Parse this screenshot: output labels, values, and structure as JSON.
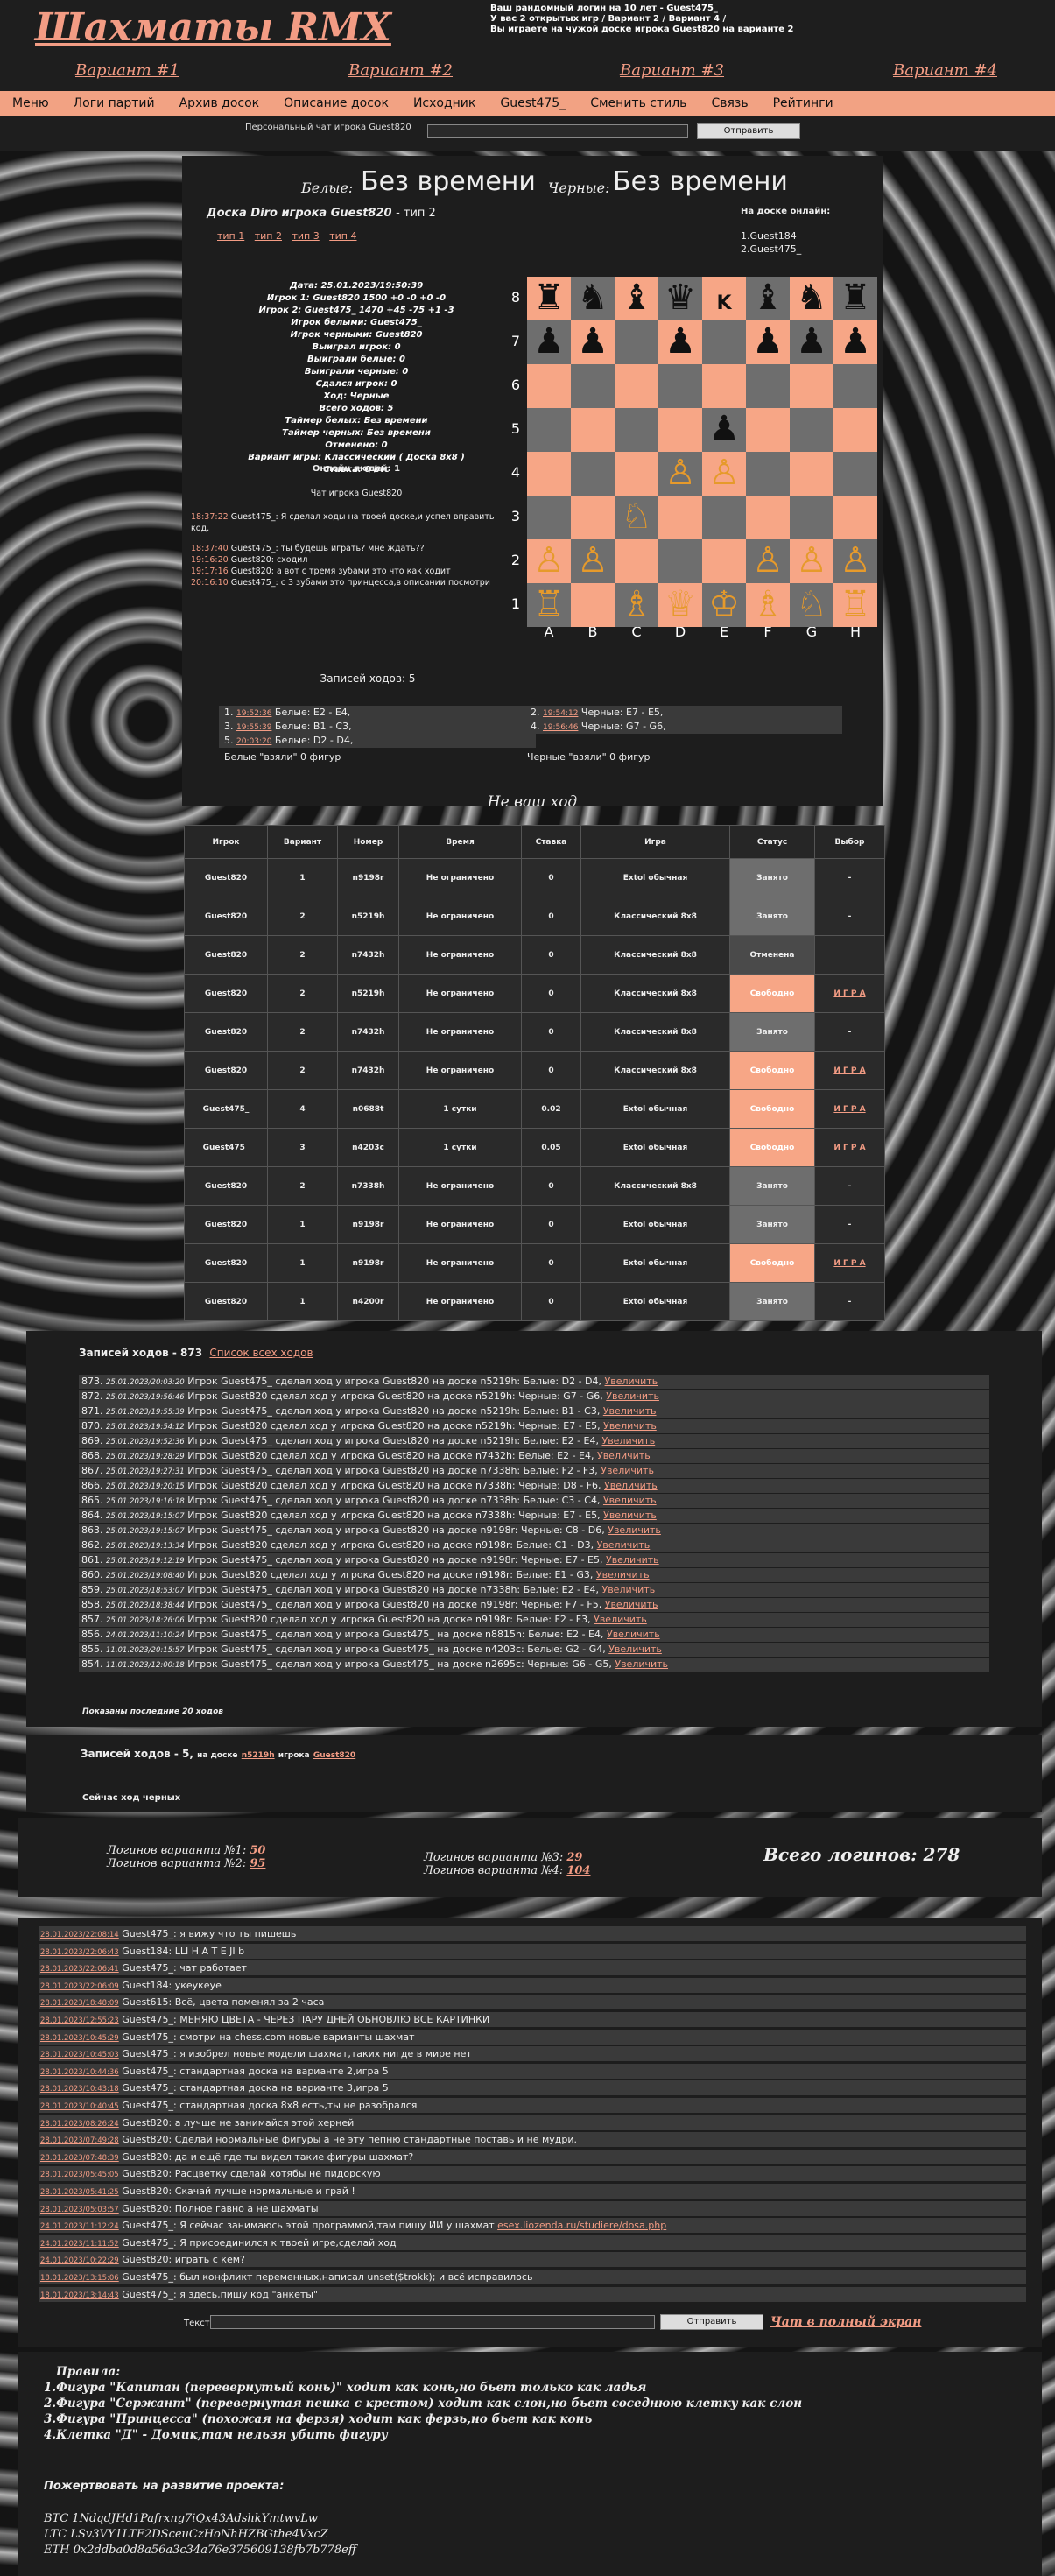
{
  "site": {
    "logo": "Шахматы RMX",
    "info": [
      "Ваш рандомный логин на 10 лет - Guest475_",
      "У вас 2 открытых игр / Вариант 2 / Вариант 4 /",
      "Вы играете на чужой доске игрока Guest820 на варианте 2"
    ]
  },
  "variants": [
    "Вариант #1",
    "Вариант #2",
    "Вариант #3",
    "Вариант #4"
  ],
  "menu": [
    "Меню",
    "Логи партий",
    "Архив досок",
    "Описание досок",
    "Исходник",
    "Guest475_",
    "Сменить стиль",
    "Связь",
    "Рейтинги"
  ],
  "private_chat": {
    "label": "Персональный чат игрока Guest820",
    "button": "Отправить"
  },
  "timers": {
    "white_label": "Белые:",
    "white_value": "Без времени",
    "black_label": "Черные:",
    "black_value": "Без времени"
  },
  "board_header": {
    "title": "Доска Diro игрока Guest820",
    "subtitle": "- тип 2",
    "types": [
      "тип 1",
      "тип 2",
      "тип 3",
      "тип 4"
    ],
    "online_label": "На доске онлайн:",
    "online": [
      "1.Guest184",
      "2.Guest475_"
    ]
  },
  "details": [
    "Дата: 25.01.2023/19:50:39",
    "Игрок 1: Guest820 1500 +0 -0 +0 -0",
    "Игрок 2: Guest475_ 1470 +45 -75 +1 -3",
    "Игрок белыми: Guest475_",
    "Игрок черными: Guest820",
    "Выиграл игрок: 0",
    "Выиграли белые: 0",
    "Выиграли черные: 0",
    "Сдался игрок: 0",
    "Ход: Черные",
    "Всего ходов: 5",
    "Таймер белых: Без времени",
    "Таймер черных: Без времени",
    "Отменено: 0",
    "Вариант игры: Классический ( Доска 8x8 )",
    "Ставка: 0 btc"
  ],
  "online_people": "Онлайн людей: 1",
  "board_chat": {
    "title": "Чат игрока Guest820",
    "messages": [
      {
        "time": "18:37:22",
        "text": "Guest475_: Я сделал ходы на твоей доске,и успел вправить код."
      },
      {
        "time": "18:37:40",
        "text": "Guest475_: ты будешь играть? мне ждать??"
      },
      {
        "time": "19:16:20",
        "text": "Guest820: сходил"
      },
      {
        "time": "19:17:16",
        "text": "Guest820: а вот с тремя зубами это что как ходит"
      },
      {
        "time": "20:16:10",
        "text": "Guest475_: с 3 зубами это принцесса,в описании посмотри"
      }
    ]
  },
  "board": {
    "files": [
      "A",
      "B",
      "C",
      "D",
      "E",
      "F",
      "G",
      "H"
    ],
    "ranks": [
      "8",
      "7",
      "6",
      "5",
      "4",
      "3",
      "2",
      "1"
    ],
    "rows": [
      [
        "♜",
        "♞",
        "♝",
        "♛",
        "K",
        "♝",
        "♞",
        "♜"
      ],
      [
        "♟",
        "♟",
        "",
        "♟",
        "",
        "♟",
        "♟",
        "♟"
      ],
      [
        "",
        "",
        "",
        "",
        "",
        "",
        "",
        ""
      ],
      [
        "",
        "",
        "",
        "",
        "♟",
        "",
        "",
        ""
      ],
      [
        "",
        "",
        "",
        "♙",
        "♙",
        "",
        "",
        ""
      ],
      [
        "",
        "",
        "♘",
        "",
        "",
        "",
        "",
        ""
      ],
      [
        "♙",
        "♙",
        "",
        "",
        "",
        "♙",
        "♙",
        "♙"
      ],
      [
        "♖",
        "",
        "♗",
        "♕",
        "♔",
        "♗",
        "♘",
        "♖"
      ]
    ]
  },
  "moves": {
    "title": "Записей ходов: 5",
    "list": [
      {
        "n": "1.",
        "time": "19:52:36",
        "text": "Белые: E2 - E4,"
      },
      {
        "n": "2.",
        "time": "19:54:12",
        "text": "Черные: E7 - E5,"
      },
      {
        "n": "3.",
        "time": "19:55:39",
        "text": "Белые: B1 - C3,"
      },
      {
        "n": "4.",
        "time": "19:56:46",
        "text": "Черные: G7 - G6,"
      },
      {
        "n": "5.",
        "time": "20:03:20",
        "text": "Белые: D2 - D4,"
      }
    ],
    "white_taken": "Белые \"взяли\" 0 фигур",
    "black_taken": "Черные \"взяли\" 0 фигур"
  },
  "not_your_move": "Не ваш ход",
  "games": {
    "headers": [
      "Игрок",
      "Вариант",
      "Номер",
      "Время",
      "Ставка",
      "Игра",
      "Статус",
      "Выбор"
    ],
    "rows": [
      [
        "Guest820",
        "1",
        "n9198r",
        "Не ограничено",
        "0",
        "Extol обычная",
        "Занято",
        "-"
      ],
      [
        "Guest820",
        "2",
        "n5219h",
        "Не ограничено",
        "0",
        "Классический 8x8",
        "Занято",
        "-"
      ],
      [
        "Guest820",
        "2",
        "n7432h",
        "Не ограничено",
        "0",
        "Классический 8x8",
        "Отменена",
        ""
      ],
      [
        "Guest820",
        "2",
        "n5219h",
        "Не ограничено",
        "0",
        "Классический 8x8",
        "Свободно",
        "И Г Р А"
      ],
      [
        "Guest820",
        "2",
        "n7432h",
        "Не ограничено",
        "0",
        "Классический 8x8",
        "Занято",
        "-"
      ],
      [
        "Guest820",
        "2",
        "n7432h",
        "Не ограничено",
        "0",
        "Классический 8x8",
        "Свободно",
        "И Г Р А"
      ],
      [
        "Guest475_",
        "4",
        "n0688t",
        "1 сутки",
        "0.02",
        "Extol обычная",
        "Свободно",
        "И Г Р А"
      ],
      [
        "Guest475_",
        "3",
        "n4203c",
        "1 сутки",
        "0.05",
        "Extol обычная",
        "Свободно",
        "И Г Р А"
      ],
      [
        "Guest820",
        "2",
        "n7338h",
        "Не ограничено",
        "0",
        "Классический 8x8",
        "Занято",
        "-"
      ],
      [
        "Guest820",
        "1",
        "n9198r",
        "Не ограничено",
        "0",
        "Extol обычная",
        "Занято",
        "-"
      ],
      [
        "Guest820",
        "1",
        "n9198r",
        "Не ограничено",
        "0",
        "Extol обычная",
        "Свободно",
        "И Г Р А"
      ],
      [
        "Guest820",
        "1",
        "n4200r",
        "Не ограничено",
        "0",
        "Extol обычная",
        "Занято",
        "-"
      ]
    ]
  },
  "log": {
    "title": "Записей ходов - 873",
    "all_link": "Список всех ходов",
    "zoom": "Увеличить",
    "footer": "Показаны последние 20 ходов",
    "rows": [
      {
        "n": "873.",
        "d": "25.01.2023/20:03:20",
        "t": "Игрок Guest475_ сделал ход у игрока Guest820 на доске n5219h: Белые: D2 - D4,"
      },
      {
        "n": "872.",
        "d": "25.01.2023/19:56:46",
        "t": "Игрок Guest820 сделал ход у игрока Guest820 на доске n5219h: Черные: G7 - G6,"
      },
      {
        "n": "871.",
        "d": "25.01.2023/19:55:39",
        "t": "Игрок Guest475_ сделал ход у игрока Guest820 на доске n5219h: Белые: B1 - C3,"
      },
      {
        "n": "870.",
        "d": "25.01.2023/19:54:12",
        "t": "Игрок Guest820 сделал ход у игрока Guest820 на доске n5219h: Черные: E7 - E5,"
      },
      {
        "n": "869.",
        "d": "25.01.2023/19:52:36",
        "t": "Игрок Guest475_ сделал ход у игрока Guest820 на доске n5219h: Белые: E2 - E4,"
      },
      {
        "n": "868.",
        "d": "25.01.2023/19:28:29",
        "t": "Игрок Guest820 сделал ход у игрока Guest820 на доске n7432h: Белые: E2 - E4,"
      },
      {
        "n": "867.",
        "d": "25.01.2023/19:27:31",
        "t": "Игрок Guest475_ сделал ход у игрока Guest820 на доске n7338h: Белые: F2 - F3,"
      },
      {
        "n": "866.",
        "d": "25.01.2023/19:20:15",
        "t": "Игрок Guest820 сделал ход у игрока Guest820 на доске n7338h: Черные: D8 - F6,"
      },
      {
        "n": "865.",
        "d": "25.01.2023/19:16:18",
        "t": "Игрок Guest475_ сделал ход у игрока Guest820 на доске n7338h: Белые: C3 - C4,"
      },
      {
        "n": "864.",
        "d": "25.01.2023/19:15:07",
        "t": "Игрок Guest820 сделал ход у игрока Guest820 на доске n7338h: Черные: E7 - E5,"
      },
      {
        "n": "863.",
        "d": "25.01.2023/19:15:07",
        "t": "Игрок Guest475_ сделал ход у игрока Guest820 на доске n9198r: Черные: C8 - D6,"
      },
      {
        "n": "862.",
        "d": "25.01.2023/19:13:34",
        "t": "Игрок Guest820 сделал ход у игрока Guest820 на доске n9198r: Белые: C1 - D3,"
      },
      {
        "n": "861.",
        "d": "25.01.2023/19:12:19",
        "t": "Игрок Guest475_ сделал ход у игрока Guest820 на доске n9198r: Черные: E7 - E5,"
      },
      {
        "n": "860.",
        "d": "25.01.2023/19:08:40",
        "t": "Игрок Guest820 сделал ход у игрока Guest820 на доске n9198r: Белые: E1 - G3,"
      },
      {
        "n": "859.",
        "d": "25.01.2023/18:53:07",
        "t": "Игрок Guest475_ сделал ход у игрока Guest820 на доске n7338h: Белые: E2 - E4,"
      },
      {
        "n": "858.",
        "d": "25.01.2023/18:38:44",
        "t": "Игрок Guest475_ сделал ход у игрока Guest820 на доске n9198r: Черные: F7 - F5,"
      },
      {
        "n": "857.",
        "d": "25.01.2023/18:26:06",
        "t": "Игрок Guest820 сделал ход у игрока Guest820 на доске n9198r: Белые: F2 - F3,"
      },
      {
        "n": "856.",
        "d": "24.01.2023/11:10:24",
        "t": "Игрок Guest475_ сделал ход у игрока Guest475_ на доске n8815h: Белые: E2 - E4,"
      },
      {
        "n": "855.",
        "d": "11.01.2023/20:15:57",
        "t": "Игрок Guest475_ сделал ход у игрока Guest475_ на доске n4203c: Белые: G2 - G4,"
      },
      {
        "n": "854.",
        "d": "11.01.2023/12:00:18",
        "t": "Игрок Guest475_ сделал ход у игрока Guest475_ на доске n2695c: Черные: G6 - G5,"
      }
    ]
  },
  "board_moves": {
    "title": "Записей ходов - 5,",
    "board_prefix": "на доске",
    "board": "n5219h",
    "player_prefix": "игрока",
    "player": "Guest820",
    "status": "Сейчас ход черных"
  },
  "stats": {
    "v1_label": "Логинов варианта №1:",
    "v1": "50",
    "v2_label": "Логинов варианта №2:",
    "v2": "95",
    "v3_label": "Логинов варианта №3:",
    "v3": "29",
    "v4_label": "Логинов варианта №4:",
    "v4": "104",
    "total": "Всего логинов: 278"
  },
  "chat": {
    "label": "Текст:",
    "button": "Отправить",
    "full": "Чат в полный экран",
    "messages": [
      {
        "d": "28.01.2023/22:08:14",
        "t": "Guest475_: я вижу что ты пишешь"
      },
      {
        "d": "28.01.2023/22:06:43",
        "t": "Guest184: LLI H A T E JI b"
      },
      {
        "d": "28.01.2023/22:06:41",
        "t": "Guest475_: чат работает"
      },
      {
        "d": "28.01.2023/22:06:09",
        "t": "Guest184: укеукеуе"
      },
      {
        "d": "28.01.2023/18:48:09",
        "t": "Guest615: Всё, цвета поменял за 2 часа"
      },
      {
        "d": "28.01.2023/12:55:23",
        "t": "Guest475_: МЕНЯЮ ЦВЕТА - ЧЕРЕЗ ПАРУ ДНЕЙ ОБНОВЛЮ ВСЕ КАРТИНКИ"
      },
      {
        "d": "28.01.2023/10:45:29",
        "t": "Guest475_: смотри на chess.com новые варианты шахмат"
      },
      {
        "d": "28.01.2023/10:45:03",
        "t": "Guest475_: я изобрел новые модели шахмат,таких нигде в мире нет"
      },
      {
        "d": "28.01.2023/10:44:36",
        "t": "Guest475_: стандартная доска на варианте 2,игра 5"
      },
      {
        "d": "28.01.2023/10:43:18",
        "t": "Guest475_: стандартная доска на варианте 3,игра 5"
      },
      {
        "d": "28.01.2023/10:40:45",
        "t": "Guest475_: стандартная доска 8x8 есть,ты не разобрался"
      },
      {
        "d": "28.01.2023/08:26:24",
        "t": "Guest820: а лучше не занимайся этой херней"
      },
      {
        "d": "28.01.2023/07:49:28",
        "t": "Guest820: Сделай нормальные фигуры а не эту пепню стандартные поставь и не мудри."
      },
      {
        "d": "28.01.2023/07:48:39",
        "t": "Guest820: да и ещё где ты видел такие фигуры шахмат?"
      },
      {
        "d": "28.01.2023/05:45:05",
        "t": "Guest820: Расцветку сделай хотябы не пидорскую"
      },
      {
        "d": "28.01.2023/05:41:25",
        "t": "Guest820: Скачай лучше нормальные и грай !"
      },
      {
        "d": "28.01.2023/05:03:57",
        "t": "Guest820: Полное гавно а не шахматы"
      },
      {
        "d": "24.01.2023/11:12:24",
        "t": "Guest475_: Я сейчас занимаюсь этой программой,там пишу ИИ у шахмат",
        "link": "esex.liozenda.ru/studiere/dosa.php"
      },
      {
        "d": "24.01.2023/11:11:52",
        "t": "Guest475_: Я присоединился к твоей игре,сделай ход"
      },
      {
        "d": "24.01.2023/10:22:29",
        "t": "Guest820: играть с кем?"
      },
      {
        "d": "18.01.2023/13:15:06",
        "t": "Guest475_: был конфликт переменных,написал unset($trokk); и всё исправилось"
      },
      {
        "d": "18.01.2023/13:14:43",
        "t": "Guest475_: я здесь,пишу код \"анкеты\""
      }
    ]
  },
  "rules": {
    "title": "Правила:",
    "items": [
      "1.Фигура \"Капитан (перевернутый конь)\" ходит как конь,но бьет только как ладья",
      "2.Фигура \"Сержант\" (перевернутая пешка с крестом) ходит как слон,но бьет соседнюю клетку как слон",
      "3.Фигура \"Принцесса\" (похожая на ферзя) ходит как ферзь,но бьет как конь",
      "4.Клетка \"Д\" - Домик,там нельзя убить фигуру"
    ]
  },
  "donate": {
    "title": "Пожертвовать на развитие проекта:",
    "wallets": [
      "BTC 1NdqdJHd1Pafrxng7iQx43AdshkYmtwvLw",
      "LTC LSv3VY1LTF2DSceuCzHoNhHZBGthe4VxcZ",
      "ETH 0x2ddba0d8a56a3c34a76e375609138fb7b778eff"
    ]
  },
  "colors": {
    "accent": "#f39c84",
    "panel": "#1d1d1d",
    "board_light": "#f7a686",
    "board_dark": "#6e6e6e"
  }
}
